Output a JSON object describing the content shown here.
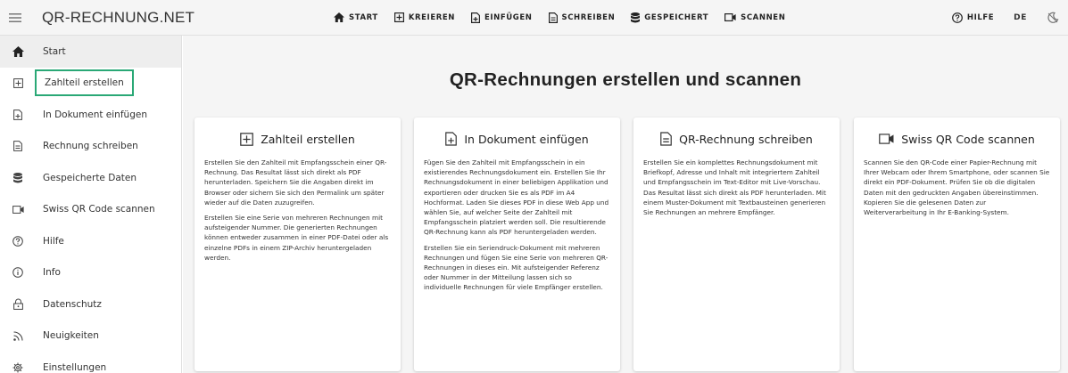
{
  "brand": "QR-RECHNUNG.NET",
  "nav": [
    {
      "label": "START",
      "icon": "home-icon"
    },
    {
      "label": "KREIEREN",
      "icon": "plus-box-icon"
    },
    {
      "label": "EINFÜGEN",
      "icon": "file-plus-icon"
    },
    {
      "label": "SCHREIBEN",
      "icon": "file-document-icon"
    },
    {
      "label": "GESPEICHERT",
      "icon": "database-icon"
    },
    {
      "label": "SCANNEN",
      "icon": "video-camera-icon"
    }
  ],
  "right_nav": {
    "help_label": "HILFE",
    "language": "DE"
  },
  "sidebar": {
    "items": [
      {
        "label": "Start",
        "icon": "home-icon"
      },
      {
        "label": "Zahlteil erstellen",
        "icon": "plus-box-icon"
      },
      {
        "label": "In Dokument einfügen",
        "icon": "file-plus-icon"
      },
      {
        "label": "Rechnung schreiben",
        "icon": "file-document-icon"
      },
      {
        "label": "Gespeicherte Daten",
        "icon": "database-icon"
      },
      {
        "label": "Swiss QR Code scannen",
        "icon": "video-camera-icon"
      },
      {
        "label": "Hilfe",
        "icon": "help-circle-icon"
      },
      {
        "label": "Info",
        "icon": "info-icon"
      },
      {
        "label": "Datenschutz",
        "icon": "lock-icon"
      },
      {
        "label": "Neuigkeiten",
        "icon": "rss-icon"
      },
      {
        "label": "Einstellungen",
        "icon": "settings-icon"
      }
    ]
  },
  "main": {
    "title": "QR-Rechnungen erstellen und scannen",
    "cards": [
      {
        "title": "Zahlteil erstellen",
        "icon": "plus-box-icon",
        "paragraphs": [
          "Erstellen Sie den Zahlteil mit Empfangsschein einer QR-Rechnung. Das Resultat lässt sich direkt als PDF herunterladen. Speichern Sie die Angaben direkt im Browser oder sichern Sie sich den Permalink um später wieder auf die Daten zuzugreifen.",
          "Erstellen Sie eine Serie von mehreren Rechnungen mit aufsteigender Nummer. Die generierten Rechnungen können entweder zusammen in einer PDF-Datei oder als einzelne PDFs in einem ZIP-Archiv heruntergeladen werden."
        ]
      },
      {
        "title": "In Dokument einfügen",
        "icon": "file-plus-icon",
        "paragraphs": [
          "Fügen Sie den Zahlteil mit Empfangsschein in ein existierendes Rechnungsdokument ein. Erstellen Sie Ihr Rechnungsdokument in einer beliebigen Applikation und exportieren oder drucken Sie es als PDF im A4 Hochformat. Laden Sie dieses PDF in diese Web App und wählen Sie, auf welcher Seite der Zahlteil mit Empfangsschein platziert werden soll. Die resultierende QR-Rechnung kann als PDF heruntergeladen werden.",
          "Erstellen Sie ein Seriendruck-Dokument mit mehreren Rechnungen und fügen Sie eine Serie von mehreren QR-Rechnungen in dieses ein. Mit aufsteigender Referenz oder Nummer in der Mitteilung lassen sich so individuelle Rechnungen für viele Empfänger erstellen."
        ]
      },
      {
        "title": "QR-Rechnung schreiben",
        "icon": "file-document-icon",
        "paragraphs": [
          "Erstellen Sie ein komplettes Rechnungsdokument mit Briefkopf, Adresse und Inhalt mit integriertem Zahlteil und Empfangsschein im Text-Editor mit Live-Vorschau. Das Resultat lässt sich direkt als PDF herunterladen. Mit einem Muster-Dokument mit Textbausteinen generieren Sie Rechnungen an mehrere Empfänger."
        ]
      },
      {
        "title": "Swiss QR Code scannen",
        "icon": "video-camera-icon",
        "paragraphs": [
          "Scannen Sie den QR-Code einer Papier-Rechnung mit Ihrer Webcam oder Ihrem Smartphone, oder scannen Sie direkt ein PDF-Dokument. Prüfen Sie ob die digitalen Daten mit den gedruckten Angaben übereinstimmen. Kopieren Sie die gelesenen Daten zur Weiterverarbeitung in Ihr E-Banking-System."
        ]
      }
    ]
  },
  "colors": {
    "highlight": "#2aa876",
    "active_bg": "#eeeeee",
    "main_bg": "#f5f5f5"
  }
}
